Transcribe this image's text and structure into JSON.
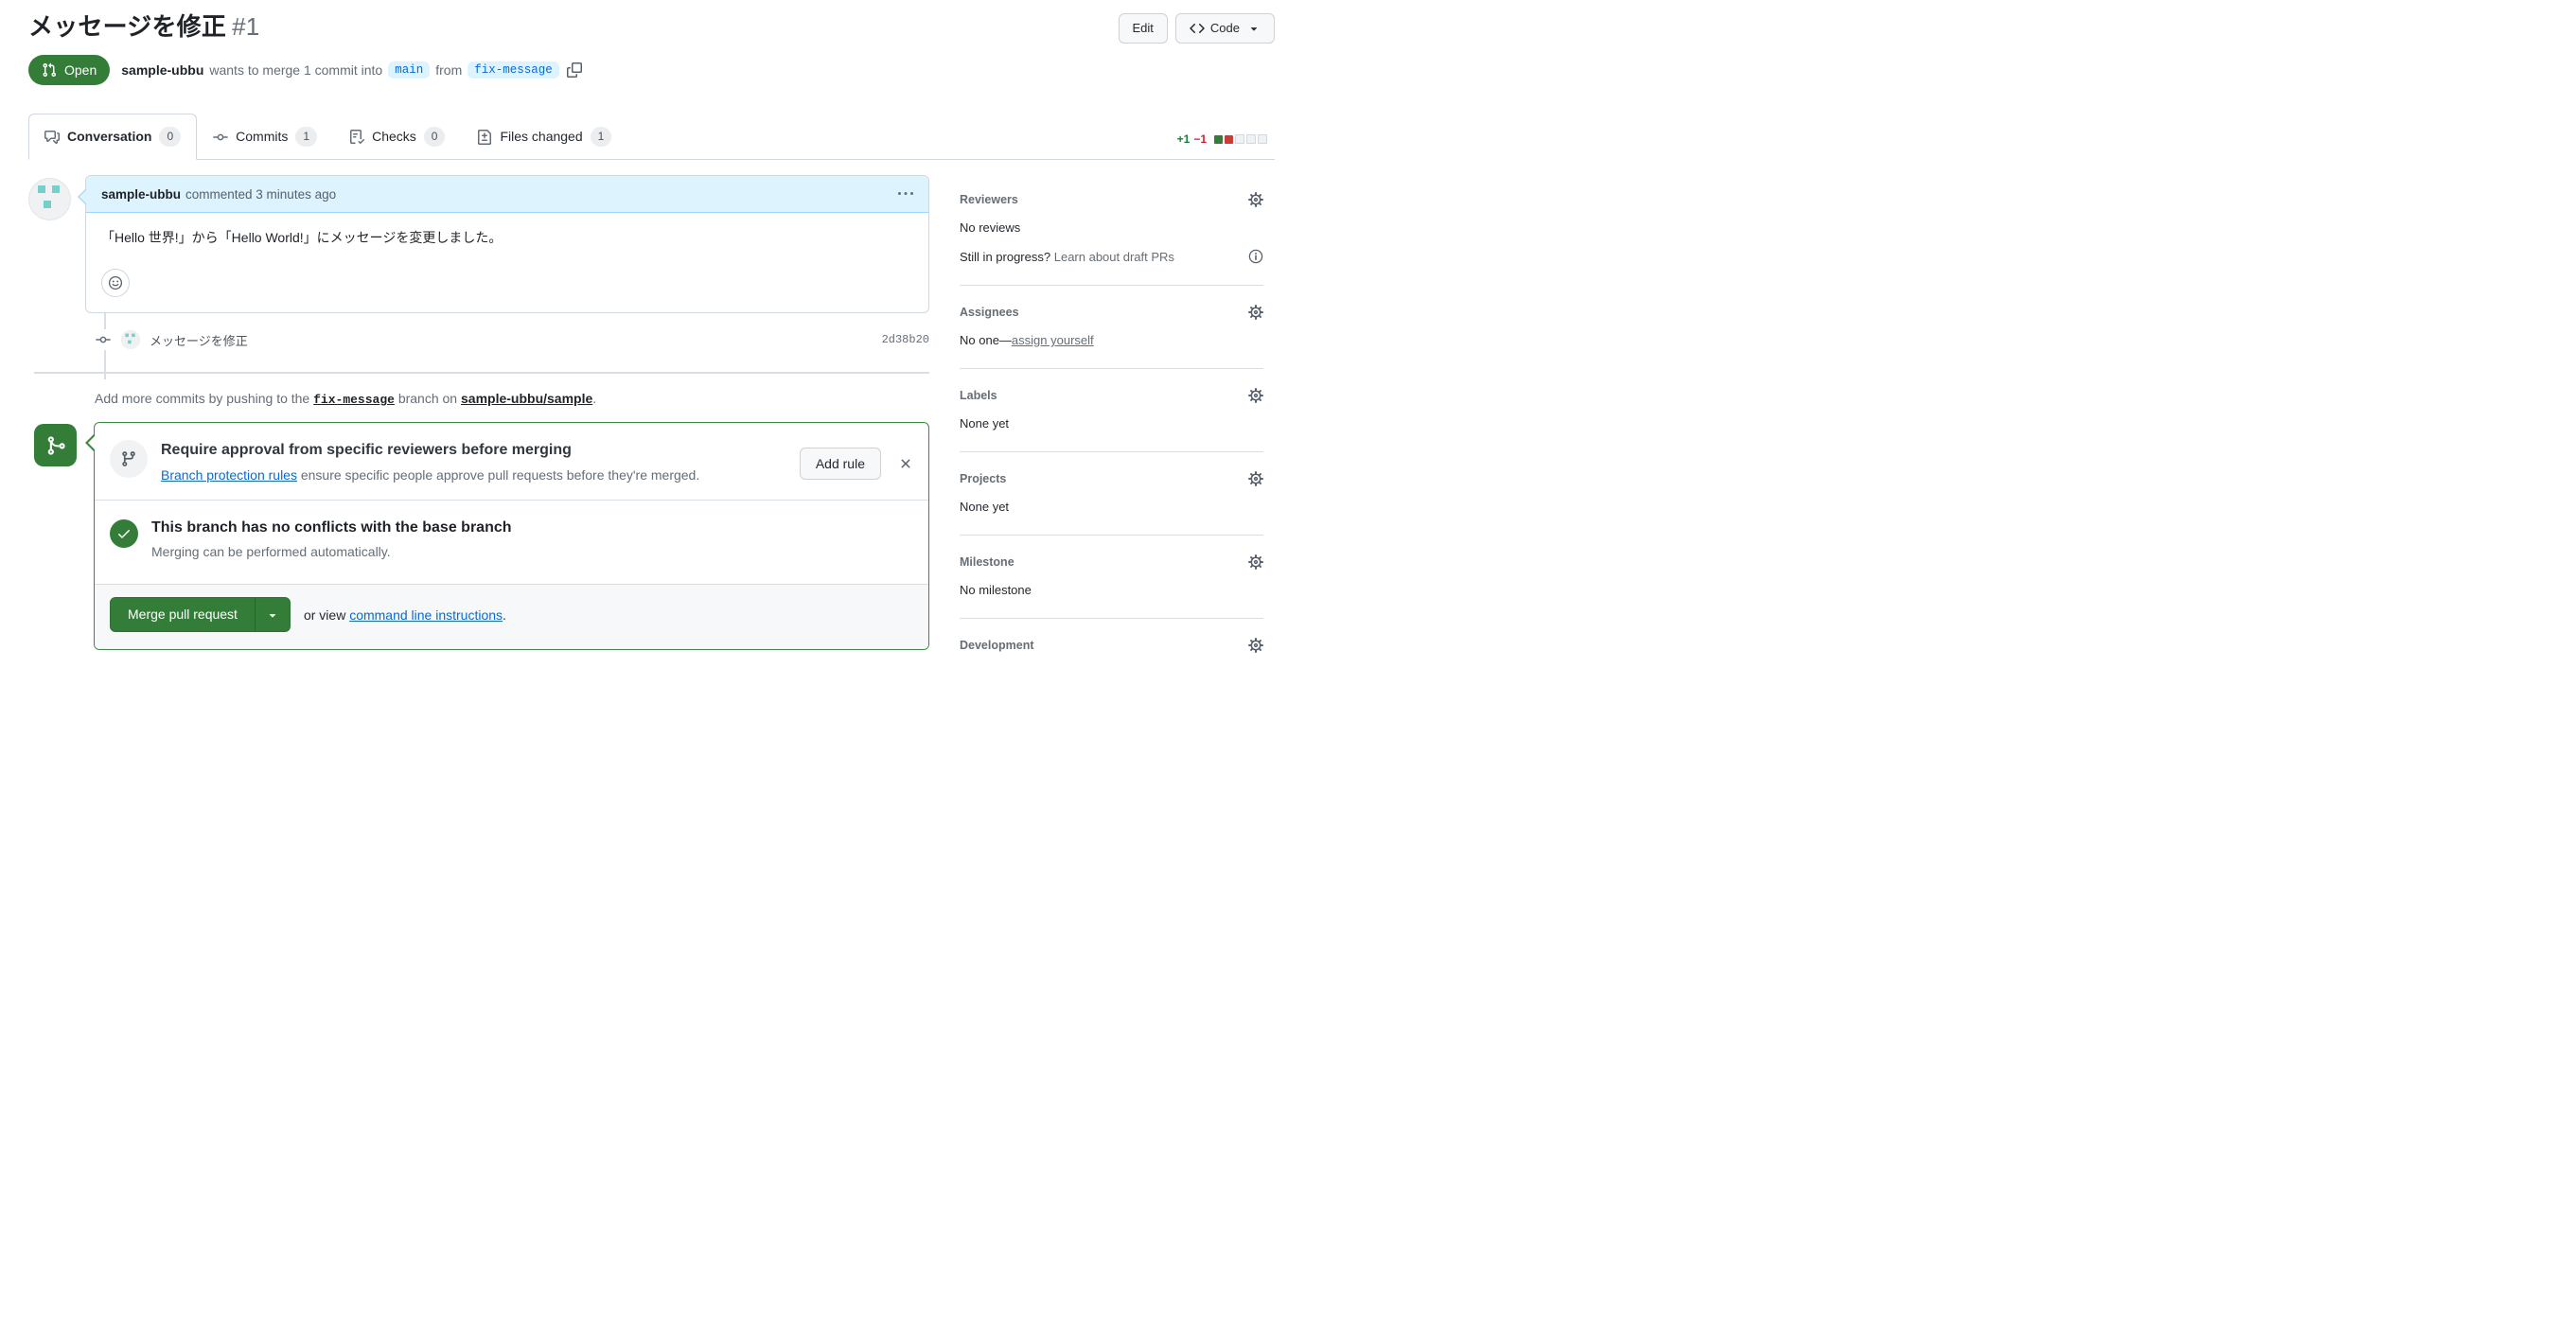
{
  "header": {
    "title": "メッセージを修正",
    "number": "#1",
    "edit_button": "Edit",
    "code_button": "Code"
  },
  "meta": {
    "state_label": "Open",
    "author": "sample-ubbu",
    "action_text": "wants to merge 1 commit into",
    "base_branch": "main",
    "from_text": "from",
    "head_branch": "fix-message"
  },
  "tabs": [
    {
      "label": "Conversation",
      "count": "0",
      "active": true
    },
    {
      "label": "Commits",
      "count": "1",
      "active": false
    },
    {
      "label": "Checks",
      "count": "0",
      "active": false
    },
    {
      "label": "Files changed",
      "count": "1",
      "active": false
    }
  ],
  "diffstat": {
    "additions": "+1",
    "deletions": "−1",
    "blocks": [
      "added",
      "deleted",
      "neutral",
      "neutral",
      "neutral"
    ]
  },
  "comment": {
    "author": "sample-ubbu",
    "meta": "commented 3 minutes ago",
    "body": "「Hello 世界!」から「Hello World!」にメッセージを変更しました。"
  },
  "commit": {
    "message": "メッセージを修正",
    "sha": "2d38b20"
  },
  "push_hint": {
    "prefix": "Add more commits by pushing to the ",
    "branch": "fix-message",
    "middle": " branch on ",
    "repo": "sample-ubbu/sample",
    "suffix": "."
  },
  "merge_box": {
    "rule": {
      "title": "Require approval from specific reviewers before merging",
      "link": "Branch protection rules",
      "description": " ensure specific people approve pull requests before they're merged.",
      "add_rule_button": "Add rule"
    },
    "status": {
      "title": "This branch has no conflicts with the base branch",
      "subtitle": "Merging can be performed automatically."
    },
    "actions": {
      "merge_button": "Merge pull request",
      "or_view": "or view ",
      "cli_link": "command line instructions",
      "suffix": "."
    }
  },
  "sidebar": {
    "reviewers": {
      "title": "Reviewers",
      "value": "No reviews",
      "hint_text": "Still in progress?",
      "hint_link": "Learn about draft PRs"
    },
    "assignees": {
      "title": "Assignees",
      "value_prefix": "No one—",
      "link": "assign yourself"
    },
    "labels": {
      "title": "Labels",
      "value": "None yet"
    },
    "projects": {
      "title": "Projects",
      "value": "None yet"
    },
    "milestone": {
      "title": "Milestone",
      "value": "No milestone"
    },
    "development": {
      "title": "Development"
    }
  },
  "colors": {
    "open_badge_green": "#347d39",
    "merge_button_green": "#347d39",
    "merge_box_border_green": "#3c8a41",
    "link_blue": "#0969da",
    "branch_label_bg": "#ddf4ff",
    "comment_header_bg": "#ddf4ff",
    "addition_green": "#1a7f37",
    "deletion_red": "#cf222e",
    "border_gray": "#d0d7de",
    "muted_text": "#656d76",
    "dark_text": "#1f2328",
    "identicon_teal": "#76d0ca"
  },
  "icons": [
    "git-pull-request-icon",
    "code-icon",
    "triangle-down-icon",
    "comment-discussion-icon",
    "git-commit-icon",
    "checklist-icon",
    "file-diff-icon",
    "copy-icon",
    "kebab-icon",
    "smiley-icon",
    "git-merge-icon",
    "git-branch-icon",
    "check-icon",
    "x-icon",
    "gear-icon",
    "info-icon",
    "identicon-avatar"
  ]
}
